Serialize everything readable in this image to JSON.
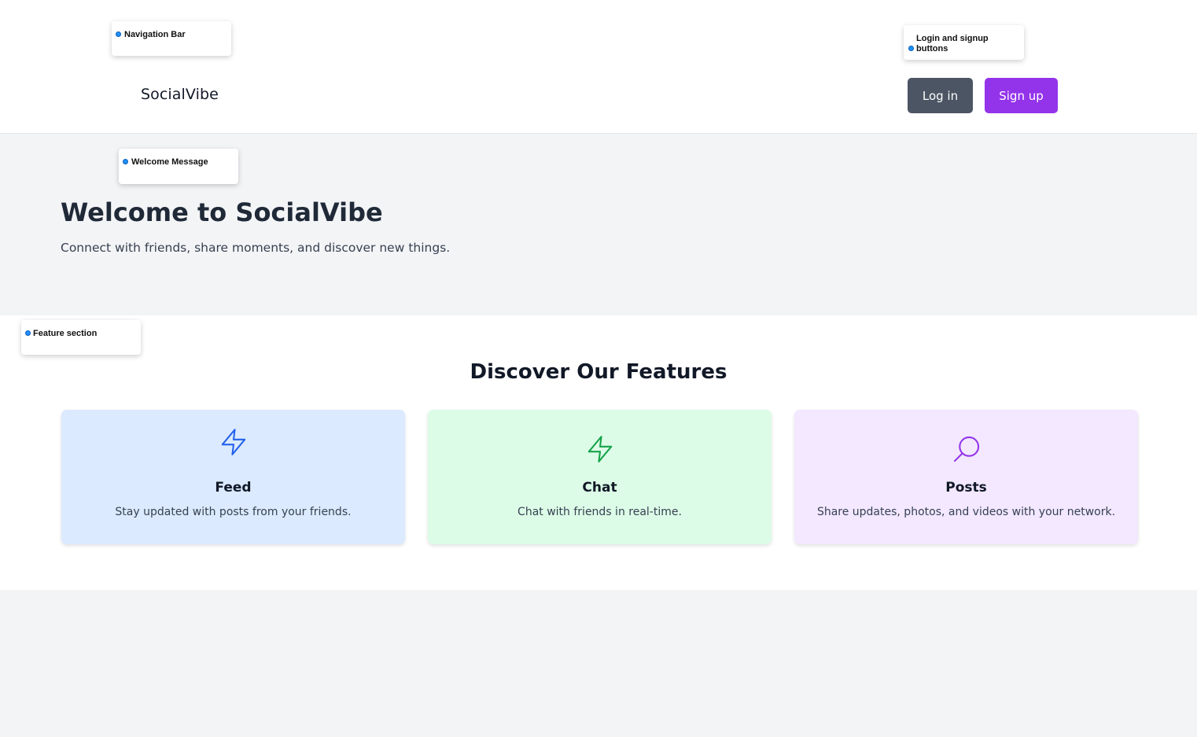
{
  "nav": {
    "brand": "SocialVibe",
    "login_label": "Log in",
    "signup_label": "Sign up"
  },
  "hero": {
    "title": "Welcome to SocialVibe",
    "subtitle": "Connect with friends, share moments, and discover new things."
  },
  "features": {
    "title": "Discover Our Features",
    "cards": [
      {
        "title": "Feed",
        "description": "Stay updated with posts from your friends.",
        "icon": "lightning-icon",
        "color": "#2563eb"
      },
      {
        "title": "Chat",
        "description": "Chat with friends in real-time.",
        "icon": "lightning-icon",
        "color": "#16a34a"
      },
      {
        "title": "Posts",
        "description": "Share updates, photos, and videos with your network.",
        "icon": "search-icon",
        "color": "#9333ea"
      }
    ]
  },
  "annotations": {
    "navigation": "Navigation Bar",
    "login_signup": "Login and signup buttons",
    "welcome": "Welcome Message",
    "features": "Feature section"
  },
  "colors": {
    "accent_purple": "#9333ea",
    "login_gray": "#4b5563",
    "background": "#f3f4f6"
  }
}
